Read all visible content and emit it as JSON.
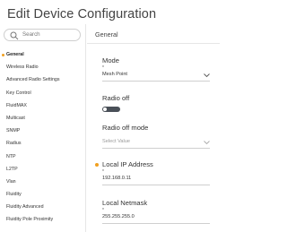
{
  "page": {
    "title": "Edit Device Configuration"
  },
  "search": {
    "placeholder": "Search"
  },
  "sidebar": {
    "items": [
      {
        "label": "General",
        "active": true
      },
      {
        "label": "Wireless Radio"
      },
      {
        "label": "Advanced Radio Settings"
      },
      {
        "label": "Key Control"
      },
      {
        "label": "FluidMAX"
      },
      {
        "label": "Multicast"
      },
      {
        "label": "SNMP"
      },
      {
        "label": "Radius"
      },
      {
        "label": "NTP"
      },
      {
        "label": "L2TP"
      },
      {
        "label": "Vlan"
      },
      {
        "label": "Fluidity"
      },
      {
        "label": "Fluidity Advanced"
      },
      {
        "label": "Fluidity Pole Proximity"
      }
    ]
  },
  "main": {
    "section_title": "General",
    "mode": {
      "label": "Mode",
      "required_mark": "*",
      "value": "Mesh Point"
    },
    "radio_off": {
      "label": "Radio off",
      "on": false
    },
    "radio_off_mode": {
      "label": "Radio off mode",
      "placeholder": "Select Value"
    },
    "local_ip": {
      "label": "Local IP Address",
      "required_mark": "*",
      "value": "192.168.0.11"
    },
    "local_netmask": {
      "label": "Local Netmask",
      "required_mark": "*",
      "value": "255.255.255.0"
    }
  },
  "colors": {
    "accent": "#f0a020",
    "toggle_off": "#4a5058"
  }
}
